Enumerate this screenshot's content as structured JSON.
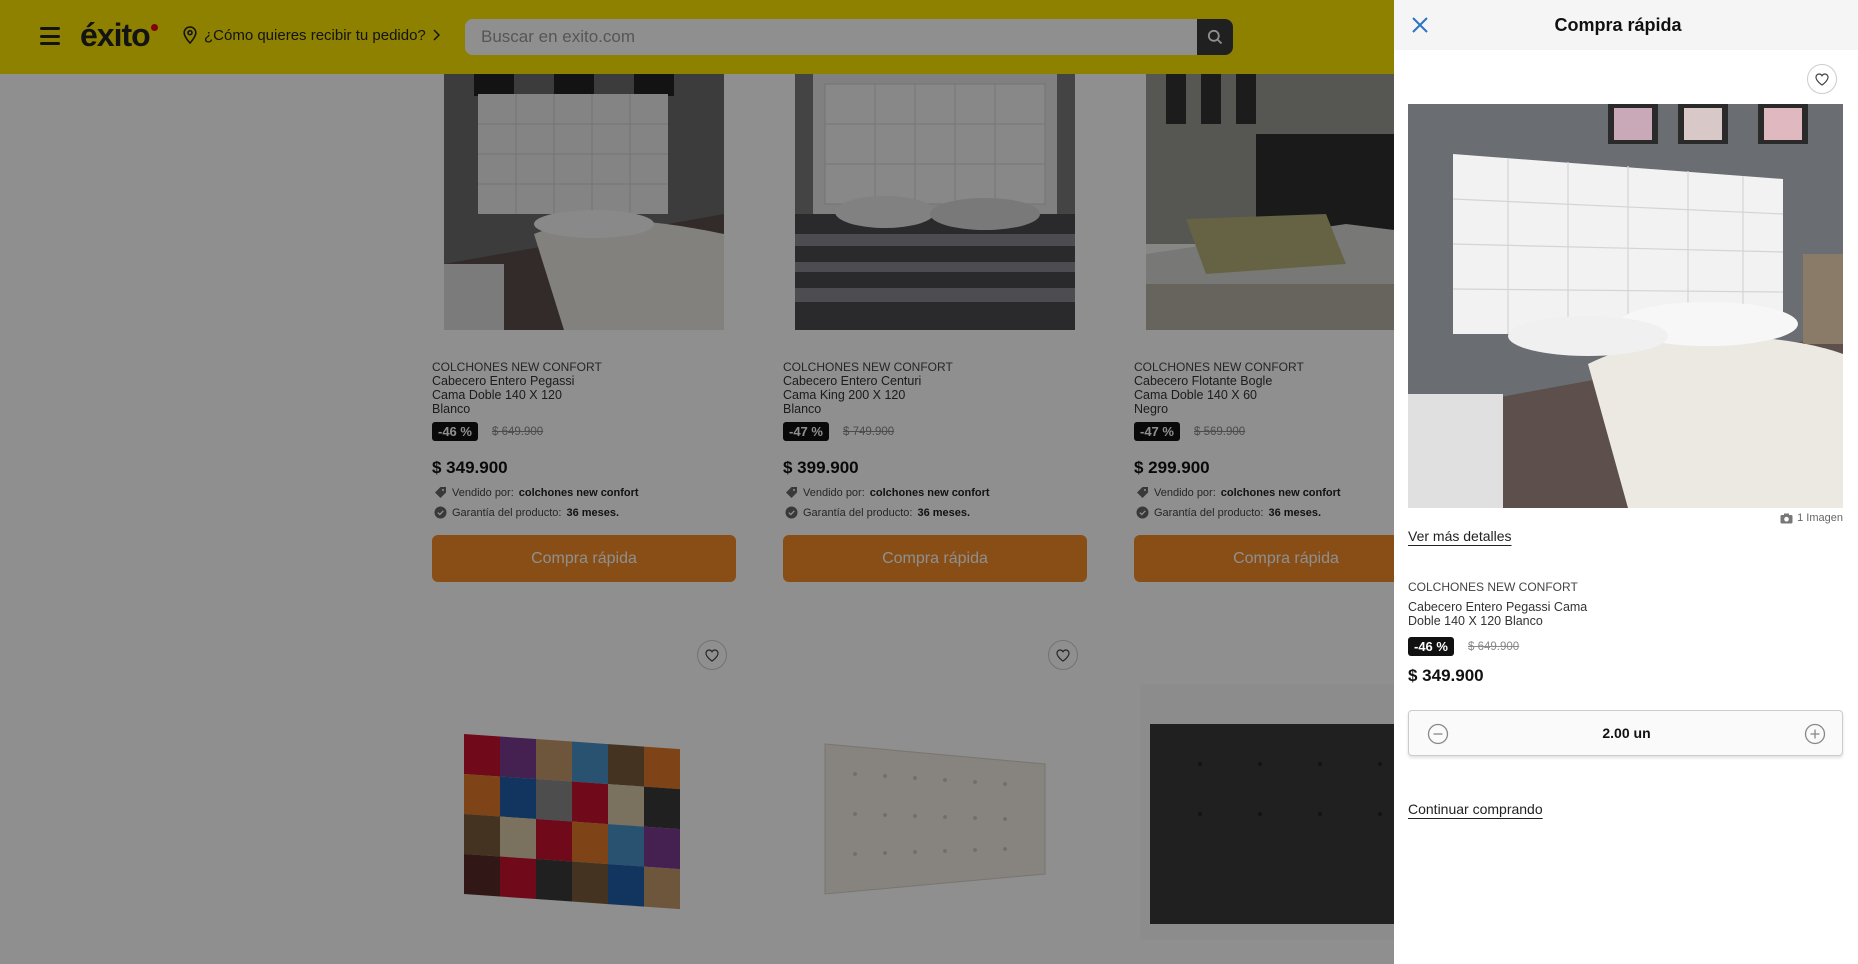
{
  "header": {
    "logo_text": "éxito",
    "location_prompt": "¿Cómo quieres recibir tu pedido?",
    "search_placeholder": "Buscar en exito.com"
  },
  "products": [
    {
      "brand": "COLCHONES NEW CONFORT",
      "name_line1": "Cabecero Entero Pegassi",
      "name_line2": "Cama Doble 140 X 120",
      "name_line3": "Blanco",
      "discount": "-46 %",
      "old_price": "$ 649.900",
      "price": "$ 349.900",
      "seller_label": "Vendido por:",
      "seller": "colchones new confort",
      "warranty_label": "Garantía del producto:",
      "warranty": "36 meses.",
      "button": "Compra rápida"
    },
    {
      "brand": "COLCHONES NEW CONFORT",
      "name_line1": "Cabecero Entero Centuri",
      "name_line2": "Cama King 200 X 120",
      "name_line3": "Blanco",
      "discount": "-47 %",
      "old_price": "$ 749.900",
      "price": "$ 399.900",
      "seller_label": "Vendido por:",
      "seller": "colchones new confort",
      "warranty_label": "Garantía del producto:",
      "warranty": "36 meses.",
      "button": "Compra rápida"
    },
    {
      "brand": "COLCHONES NEW CONFORT",
      "name_line1": "Cabecero Flotante Bogle",
      "name_line2": "Cama Doble 140 X 60",
      "name_line3": "Negro",
      "discount": "-47 %",
      "old_price": "$ 569.900",
      "price": "$ 299.900",
      "seller_label": "Vendido por:",
      "seller": "colchones new confort",
      "warranty_label": "Garantía del producto:",
      "warranty": "36 meses.",
      "button": "Compra rápida"
    }
  ],
  "drawer": {
    "title": "Compra rápida",
    "image_count": "1 Imagen",
    "details_link": "Ver más detalles",
    "brand": "COLCHONES NEW CONFORT",
    "name_line1": "Cabecero Entero Pegassi Cama",
    "name_line2": "Doble 140 X 120 Blanco",
    "discount": "-46 %",
    "old_price": "$ 649.900",
    "price": "$ 349.900",
    "quantity": "2.00 un",
    "continue_link": "Continuar comprando"
  },
  "colors": {
    "header_bg": "#fde700",
    "quick_buy": "#f28c28",
    "discount_badge": "#111111"
  }
}
